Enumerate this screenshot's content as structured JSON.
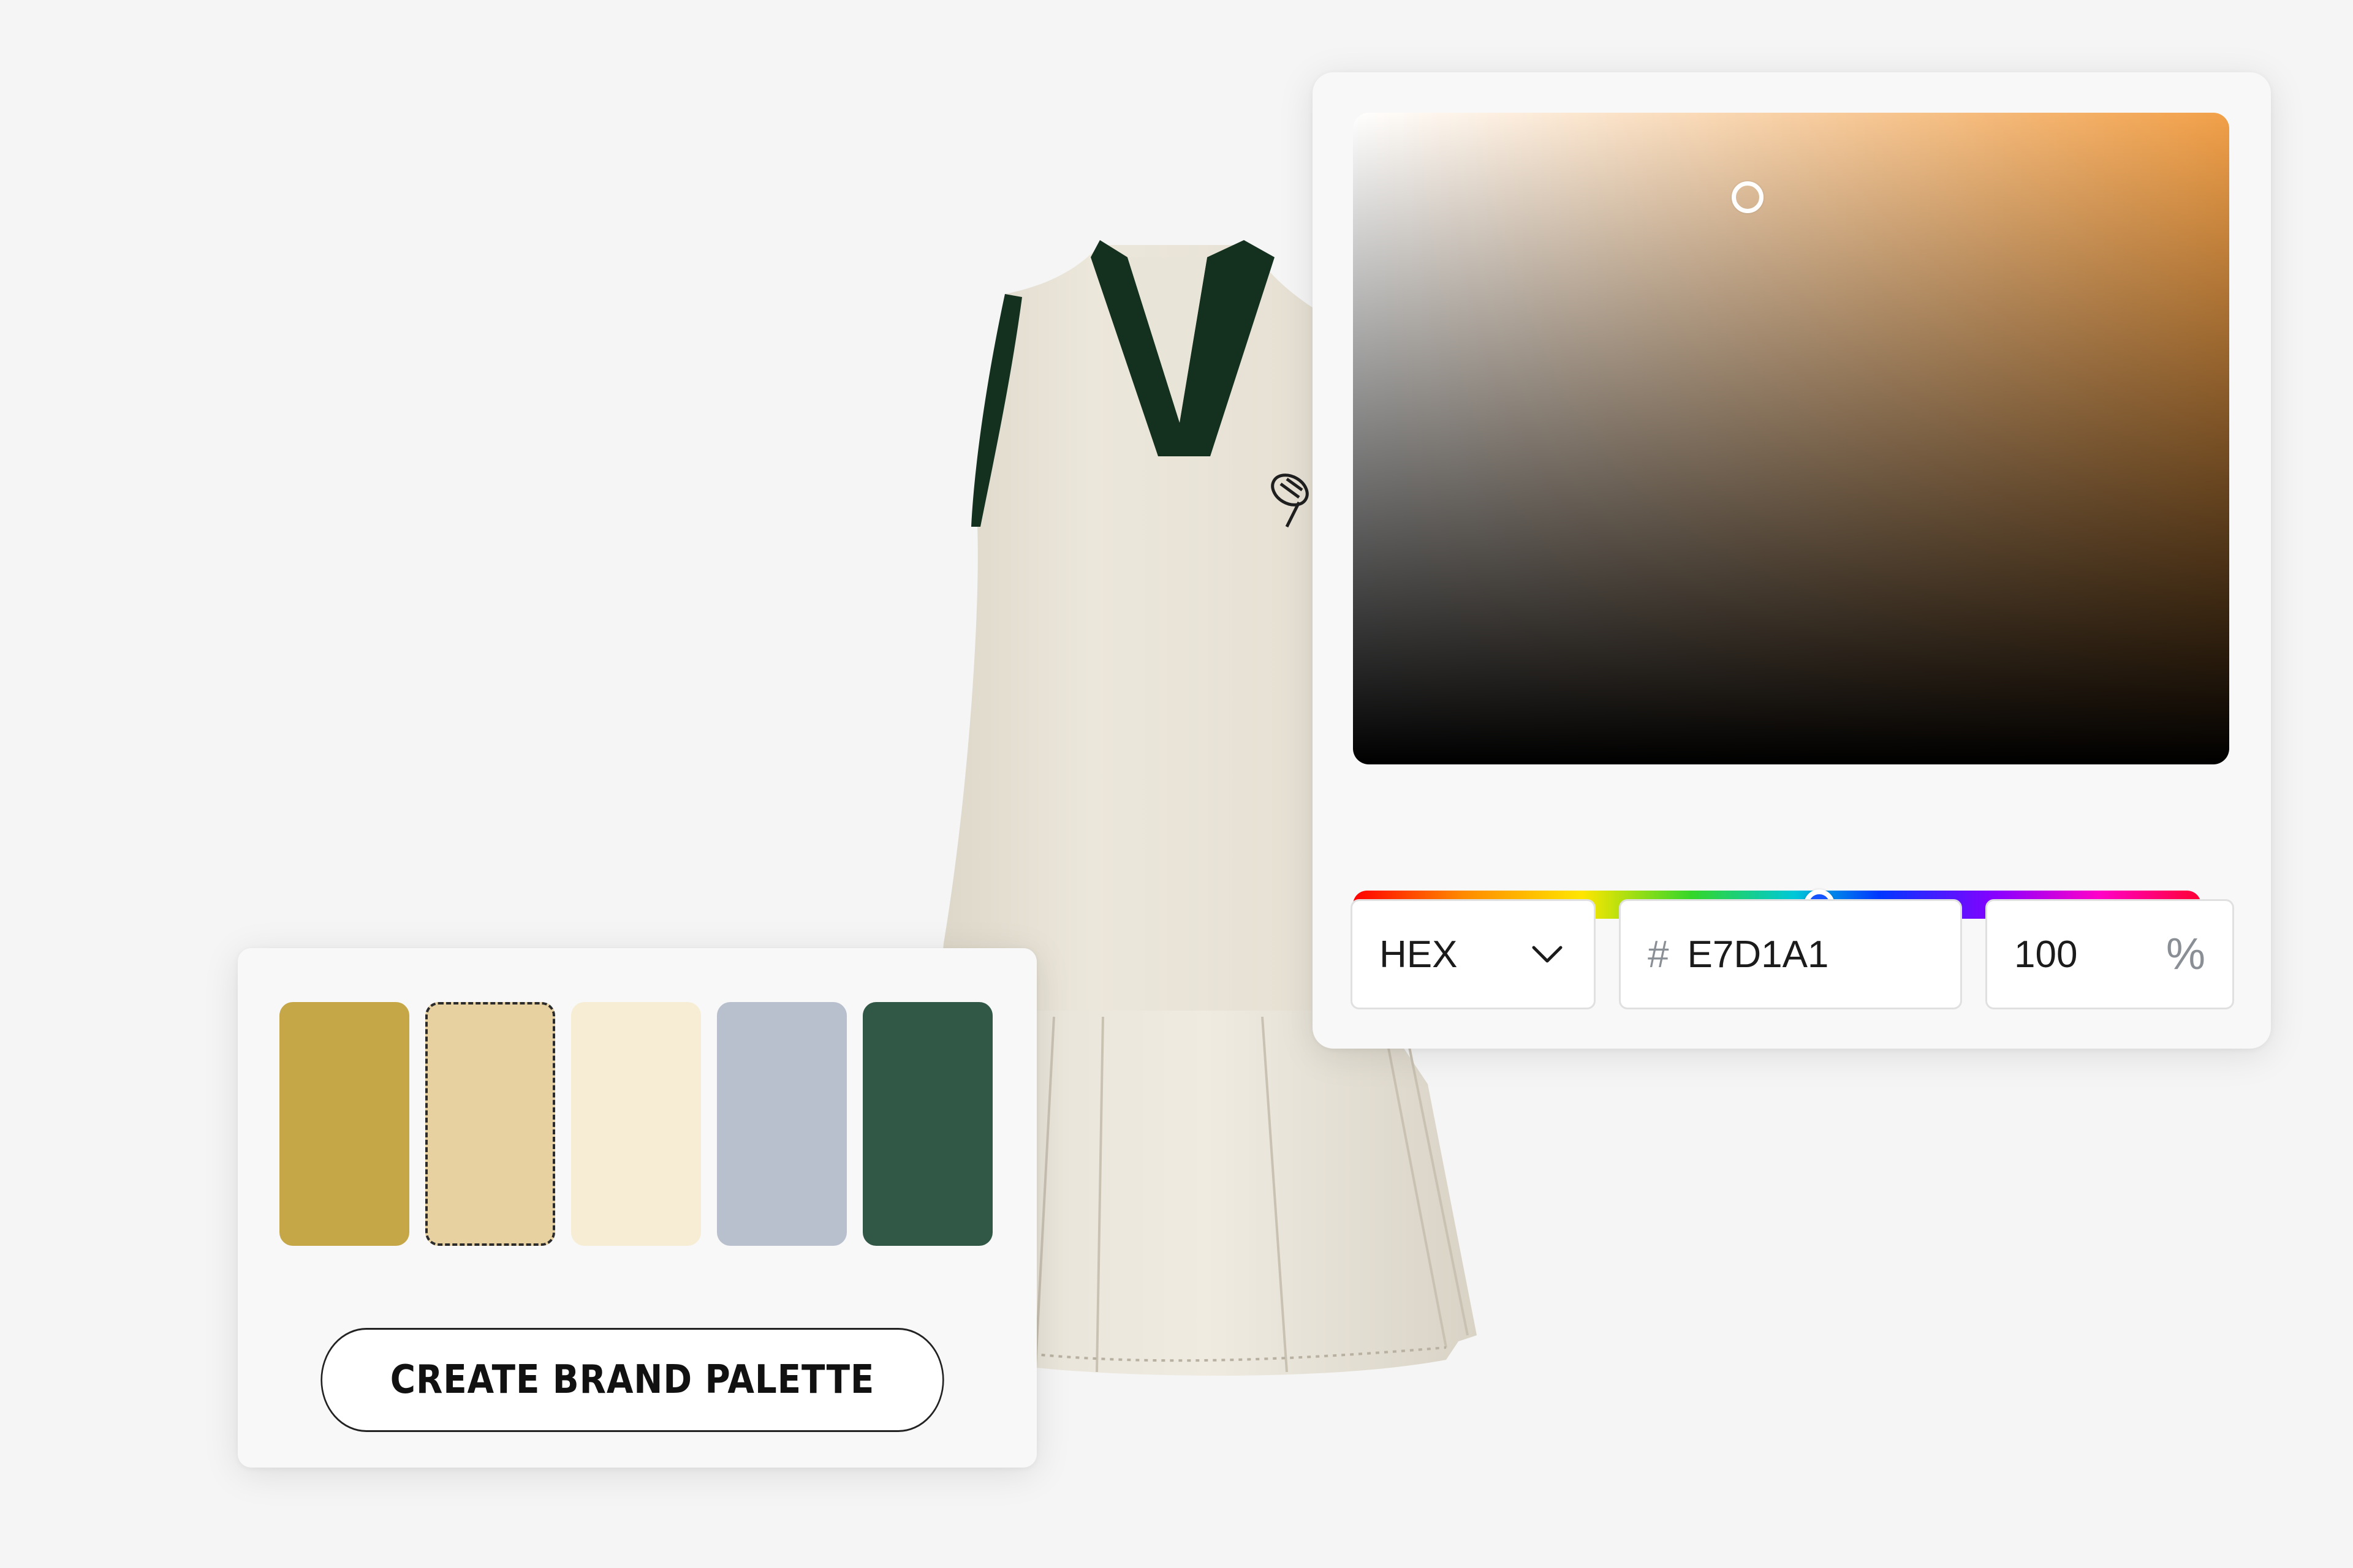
{
  "color_picker": {
    "mode_label": "HEX",
    "hash_symbol": "#",
    "hex_value": "E7D1A1",
    "alpha_value": "100",
    "alpha_unit": "%",
    "saturation_fraction": 0.45,
    "brightness_fraction": 0.87,
    "hue_fraction": 0.55,
    "base_hue_color": "#F2A048"
  },
  "palette": {
    "swatches": [
      {
        "color": "#C5A748",
        "selected": false
      },
      {
        "color": "#E7D1A1",
        "selected": true
      },
      {
        "color": "#F6EDD4",
        "selected": false
      },
      {
        "color": "#B9C0CD",
        "selected": false
      },
      {
        "color": "#315746",
        "selected": false
      }
    ],
    "button_label": "CREATE BRAND PALETTE"
  },
  "product": {
    "garment_color": "#EAE5D9",
    "trim_color": "#14301F",
    "logo_icon": "tennis-racket-icon"
  }
}
